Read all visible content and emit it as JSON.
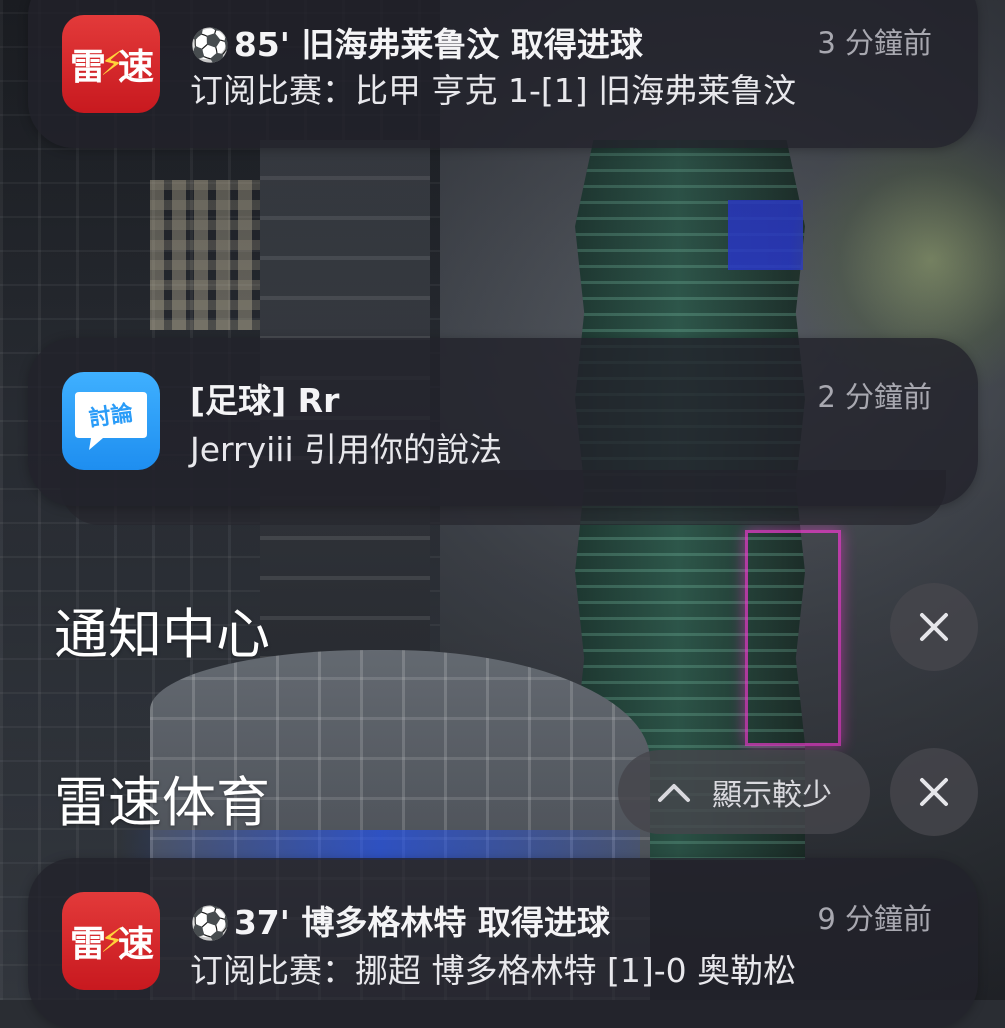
{
  "notifications": [
    {
      "app_icon": "leisu-sports-app-icon",
      "icon_text_left": "雷",
      "icon_text_right": "速",
      "title_icon": "soccer-ball-icon",
      "title": "85' 旧海弗莱鲁汶 取得进球",
      "body": "订阅比赛：比甲 亨克 1-[1] 旧海弗莱鲁汶",
      "time": "3 分鐘前"
    },
    {
      "app_icon": "forum-chat-app-icon",
      "icon_text": "討論",
      "title": "[足球] Rr",
      "body": "Jerryiii 引用你的說法",
      "time": "2 分鐘前"
    },
    {
      "app_icon": "leisu-sports-app-icon",
      "icon_text_left": "雷",
      "icon_text_right": "速",
      "title_icon": "soccer-ball-icon",
      "title": "37' 博多格林特 取得进球",
      "body": "订阅比赛：挪超 博多格林特 [1]-0 奥勒松",
      "time": "9 分鐘前"
    }
  ],
  "notification_center": {
    "title": "通知中心",
    "clear_icon": "close-icon"
  },
  "app_group": {
    "title": "雷速体育",
    "show_less_icon": "chevron-up-icon",
    "show_less_label": "顯示較少",
    "clear_icon": "close-icon"
  },
  "colors": {
    "card_background": "#22222a",
    "leisu_icon_red": "#d82228",
    "leisu_bolt_yellow": "#ffd33a",
    "forum_icon_blue": "#2a9cf8",
    "time_text": "#a8a8b0"
  }
}
